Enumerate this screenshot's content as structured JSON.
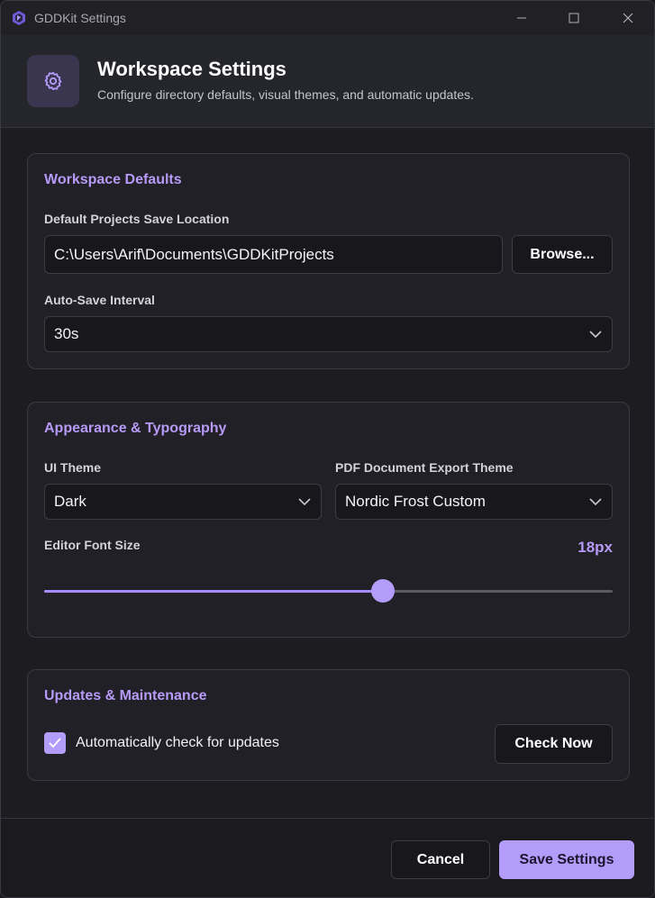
{
  "window": {
    "title": "GDDKit Settings",
    "controls": [
      "minimize-icon",
      "maximize-icon",
      "close-icon"
    ]
  },
  "header": {
    "icon": "gear-icon",
    "title": "Workspace Settings",
    "subtitle": "Configure directory defaults, visual themes, and automatic updates."
  },
  "workspace_defaults": {
    "title": "Workspace Defaults",
    "save_location_label": "Default Projects Save Location",
    "save_location_value": "C:\\Users\\Arif\\Documents\\GDDKitProjects",
    "browse_label": "Browse...",
    "autosave_label": "Auto-Save Interval",
    "autosave_value": "30s"
  },
  "appearance": {
    "title": "Appearance & Typography",
    "ui_theme_label": "UI Theme",
    "ui_theme_value": "Dark",
    "pdf_theme_label": "PDF Document Export Theme",
    "pdf_theme_value": "Nordic Frost Custom",
    "font_size_label": "Editor Font Size",
    "font_size_value": "18px",
    "font_size_slider_fraction": 0.596
  },
  "updates": {
    "title": "Updates & Maintenance",
    "auto_check_label": "Automatically check for updates",
    "auto_check_checked": true,
    "check_now_label": "Check Now"
  },
  "footer": {
    "cancel_label": "Cancel",
    "save_label": "Save Settings"
  },
  "colors": {
    "accent": "#b49cfb",
    "accent_text": "#b79af7",
    "background": "#1c1c21",
    "card": "#202026"
  }
}
